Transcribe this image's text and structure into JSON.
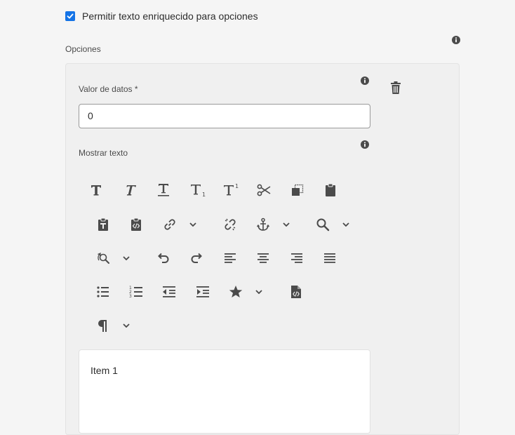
{
  "rich_text_checkbox": {
    "label": "Permitir texto enriquecido para opciones",
    "checked": true
  },
  "options": {
    "section_label": "Opciones",
    "data_value_label": "Valor de datos *",
    "data_value": "0",
    "display_text_label": "Mostrar texto",
    "editor_content": "Item 1"
  },
  "toolbar": {
    "buttons": [
      "bold-icon",
      "italic-icon",
      "underline-icon",
      "subscript-icon",
      "superscript-icon",
      "cut-icon",
      "copy-icon",
      "paste-icon",
      "paste-as-text-icon",
      "paste-from-html-icon",
      "link-icon",
      "unlink-icon",
      "anchor-icon",
      "find-icon",
      "find-replace-icon",
      "undo-icon",
      "redo-icon",
      "align-left-icon",
      "align-center-icon",
      "align-right-icon",
      "align-justify-icon",
      "bullet-list-icon",
      "numbered-list-icon",
      "outdent-icon",
      "indent-icon",
      "special-character-icon",
      "source-edit-icon",
      "paragraph-icon"
    ]
  },
  "colors": {
    "accent": "#1473e6",
    "icon": "#4b4b4b",
    "background": "#f5f5f5",
    "panel": "#f0f0f0"
  }
}
